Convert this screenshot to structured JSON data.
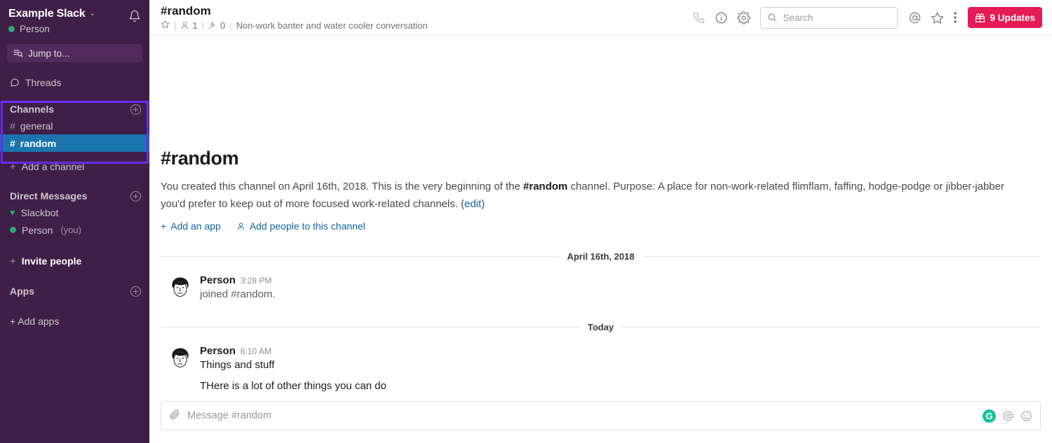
{
  "sidebar": {
    "team_name": "Example Slack",
    "chevron": "⌄",
    "presence_name": "Person",
    "jump_to_label": "Jump to...",
    "threads_label": "Threads",
    "channels": {
      "title": "Channels",
      "items": [
        {
          "name": "general",
          "hash": "#",
          "active": false
        },
        {
          "name": "random",
          "hash": "#",
          "active": true
        }
      ],
      "add_label": "Add a channel",
      "add_plus": "+"
    },
    "direct_messages": {
      "title": "Direct Messages",
      "items": [
        {
          "name": "Slackbot",
          "suffix": ""
        },
        {
          "name": "Person",
          "suffix": "(you)"
        }
      ]
    },
    "invite_label": "Invite people",
    "invite_plus": "+",
    "apps": {
      "title": "Apps",
      "add_label": "+ Add apps"
    }
  },
  "header": {
    "channel_title": "#random",
    "member_count": "1",
    "pin_count": "0",
    "topic": "Non-work banter and water cooler conversation",
    "separator": "|",
    "search_placeholder": "Search",
    "updates_label": "9 Updates"
  },
  "intro": {
    "title": "#random",
    "text_part1": "You created this channel on April 16th, 2018. This is the very beginning of the ",
    "channel_bold": "#random",
    "text_part2": " channel. Purpose: A place for non-work-related flimflam, faffing, hodge-podge or jibber-jabber you'd prefer to keep out of more focused work-related channels. (",
    "edit_link": "edit",
    "text_part3": ")",
    "add_app_label": "Add an app",
    "add_app_plus": "+",
    "add_people_label": "Add people to this channel"
  },
  "messages": {
    "divider_1": "April 16th, 2018",
    "divider_2": "Today",
    "items": [
      {
        "author": "Person",
        "time": "3:28 PM",
        "lines": [
          "joined #random."
        ]
      },
      {
        "author": "Person",
        "time": "6:10 AM",
        "lines": [
          "Things and stuff",
          "THere is a lot of other things you can do"
        ]
      }
    ]
  },
  "composer": {
    "placeholder": "Message #random",
    "grammarly_glyph": "G"
  },
  "colors": {
    "sidebar_bg": "#3F1F47",
    "active_channel": "#1B74AC",
    "annotation_border": "#6A2BF2",
    "updates_button": "#E41B54",
    "link_blue": "#1264A3",
    "presence_green": "#2BAC76",
    "grammarly_green": "#15C39A"
  }
}
